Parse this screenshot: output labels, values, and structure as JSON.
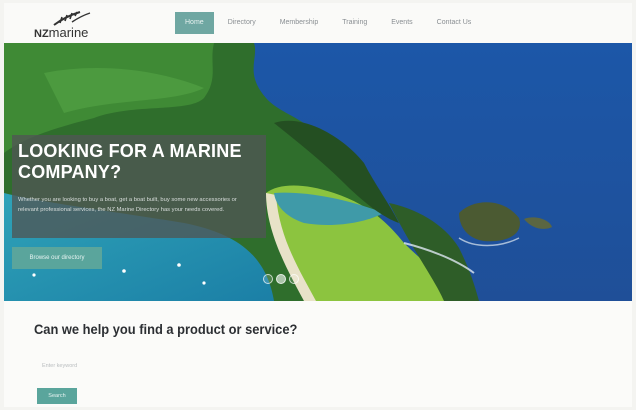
{
  "brand": {
    "prefix": "NZ",
    "name": "marine"
  },
  "nav": {
    "items": [
      {
        "label": "Home",
        "active": true
      },
      {
        "label": "Directory"
      },
      {
        "label": "Membership"
      },
      {
        "label": "Training"
      },
      {
        "label": "Events"
      },
      {
        "label": "Contact Us"
      }
    ]
  },
  "hero": {
    "title": "LOOKING FOR A MARINE COMPANY?",
    "text": "Whether you are looking to buy a boat, get a boat built, buy some new accessories or relevant professional services, the NZ Marine Directory has your needs covered.",
    "button": "Browse our directory",
    "slides": 3,
    "active_slide": 2
  },
  "search": {
    "heading": "Can we help you find a product or service?",
    "placeholder": "Enter keyword",
    "button": "Search"
  },
  "colors": {
    "accent": "#5aa59c",
    "nav_active": "#6fa7a2",
    "panel": "#50564f"
  }
}
